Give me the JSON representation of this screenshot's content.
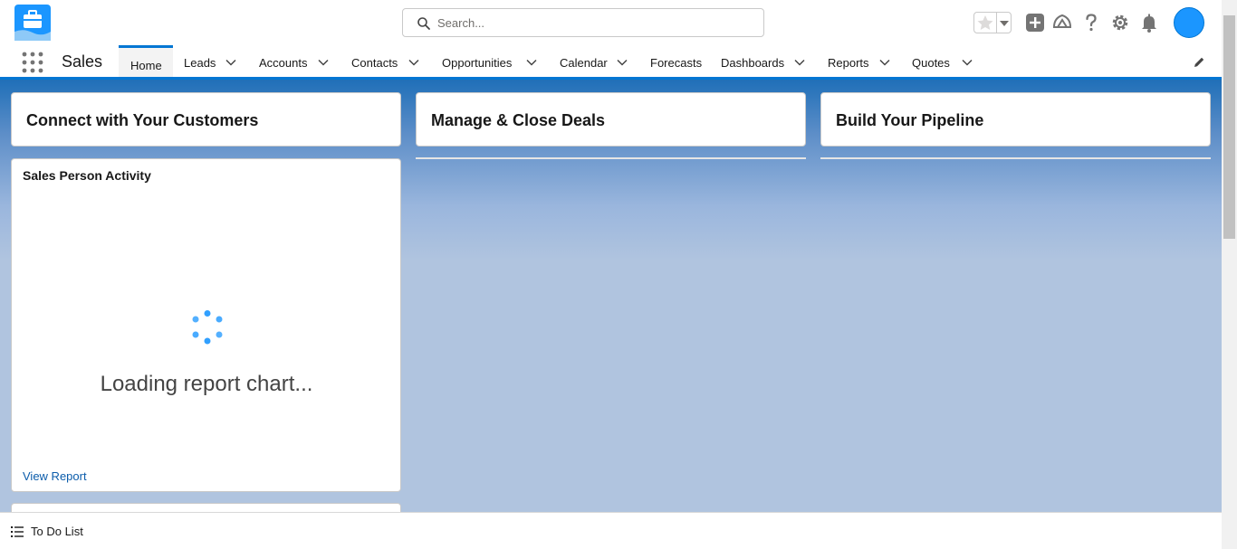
{
  "header": {
    "search_placeholder": "Search...",
    "icons": [
      "favorites-star-icon",
      "favorites-dropdown-icon",
      "global-actions-icon",
      "trailhead-icon",
      "help-icon",
      "setup-gear-icon",
      "notifications-bell-icon",
      "user-avatar"
    ]
  },
  "nav": {
    "app_name": "Sales",
    "tabs": [
      {
        "label": "Home",
        "has_menu": false,
        "active": true
      },
      {
        "label": "Leads",
        "has_menu": true
      },
      {
        "label": "Accounts",
        "has_menu": true
      },
      {
        "label": "Contacts",
        "has_menu": true
      },
      {
        "label": "Opportunities",
        "has_menu": true
      },
      {
        "label": "Calendar",
        "has_menu": true
      },
      {
        "label": "Forecasts",
        "has_menu": false
      },
      {
        "label": "Dashboards",
        "has_menu": true
      },
      {
        "label": "Reports",
        "has_menu": true
      },
      {
        "label": "Quotes",
        "has_menu": true
      }
    ]
  },
  "columns": [
    {
      "title": "Connect with Your Customers"
    },
    {
      "title": "Manage & Close Deals"
    },
    {
      "title": "Build Your Pipeline"
    }
  ],
  "report_card": {
    "title": "Sales Person Activity",
    "loading_text": "Loading report chart...",
    "link": "View Report"
  },
  "footer": {
    "todo_label": "To Do List"
  },
  "colors": {
    "brand": "#0176d3",
    "avatar": "#1b96ff",
    "link": "#0b5cab",
    "background": "#b0c4df"
  }
}
